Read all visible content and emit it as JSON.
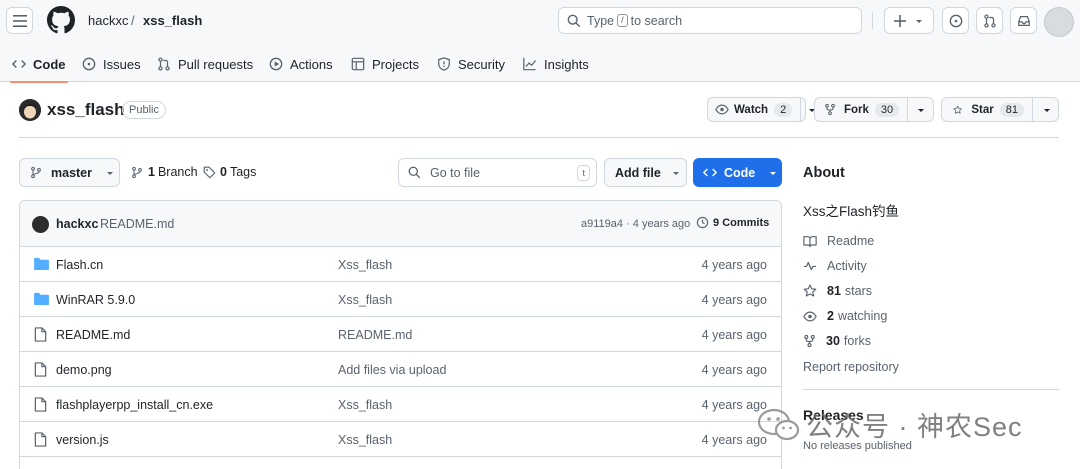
{
  "header": {
    "owner": "hackxc",
    "separator": "/",
    "repo": "xss_flash",
    "search_prefix": "Type",
    "search_key": "/",
    "search_suffix": "to search"
  },
  "tabs": [
    {
      "label": "Code",
      "icon": "code-icon",
      "active": true
    },
    {
      "label": "Issues",
      "icon": "issue-icon"
    },
    {
      "label": "Pull requests",
      "icon": "pull-request-icon"
    },
    {
      "label": "Actions",
      "icon": "play-icon"
    },
    {
      "label": "Projects",
      "icon": "table-icon"
    },
    {
      "label": "Security",
      "icon": "shield-icon"
    },
    {
      "label": "Insights",
      "icon": "graph-icon"
    }
  ],
  "repo": {
    "name": "xss_flash",
    "visibility": "Public",
    "watch_label": "Watch",
    "watch_count": "2",
    "fork_label": "Fork",
    "fork_count": "30",
    "star_label": "Star",
    "star_count": "81"
  },
  "toolbar": {
    "branch": "master",
    "branch_count": "1",
    "branch_label": "Branch",
    "tag_count": "0",
    "tag_label": "Tags",
    "goto_placeholder": "Go to file",
    "goto_key": "t",
    "add_file": "Add file",
    "code": "Code"
  },
  "latest_commit": {
    "user": "hackxc",
    "message": "README.md",
    "sha_time": "a9119a4 · 4 years ago",
    "commits_count": "9",
    "commits_label": "Commits"
  },
  "files": [
    {
      "type": "folder",
      "name": "Flash.cn",
      "message": "Xss_flash",
      "date": "4 years ago"
    },
    {
      "type": "folder",
      "name": "WinRAR 5.9.0",
      "message": "Xss_flash",
      "date": "4 years ago"
    },
    {
      "type": "file",
      "name": "README.md",
      "message": "README.md",
      "date": "4 years ago"
    },
    {
      "type": "file",
      "name": "demo.png",
      "message": "Add files via upload",
      "date": "4 years ago"
    },
    {
      "type": "file",
      "name": "flashplayerpp_install_cn.exe",
      "message": "Xss_flash",
      "date": "4 years ago"
    },
    {
      "type": "file",
      "name": "version.js",
      "message": "Xss_flash",
      "date": "4 years ago"
    }
  ],
  "about": {
    "heading": "About",
    "description": "Xss之Flash钓鱼",
    "readme": "Readme",
    "activity": "Activity",
    "stars_count": "81",
    "stars_label": "stars",
    "watching_count": "2",
    "watching_label": "watching",
    "forks_count": "30",
    "forks_label": "forks",
    "report": "Report repository",
    "releases_heading": "Releases",
    "releases_sub": "No releases published"
  },
  "watermark": "公众号 · 神农Sec",
  "colors": {
    "accent_blue": "#1f6feb",
    "tab_underline": "#fd8c73",
    "folder_blue": "#54aeff"
  }
}
